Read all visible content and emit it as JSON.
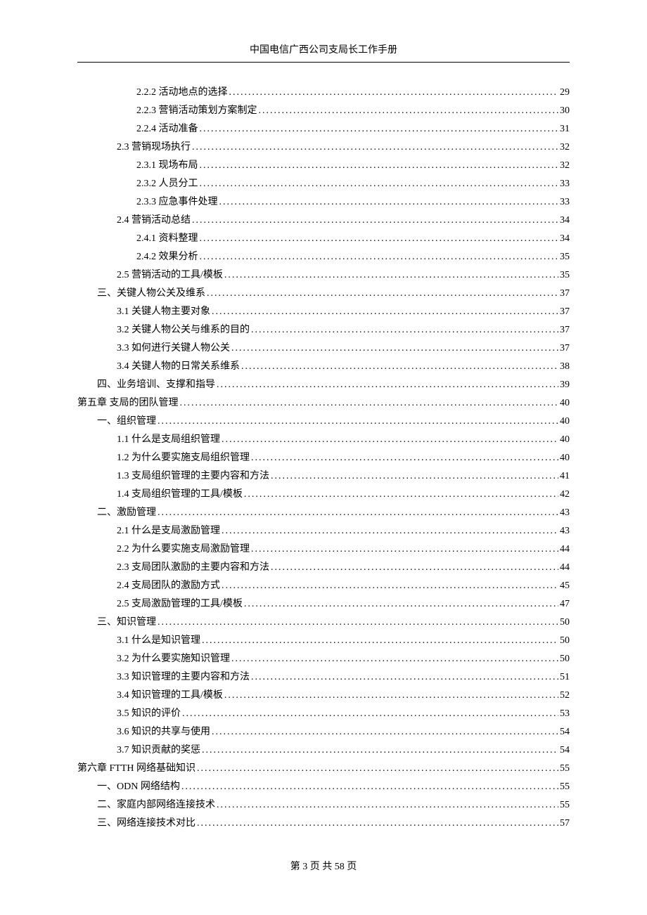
{
  "header": {
    "title": "中国电信广西公司支局长工作手册"
  },
  "toc": [
    {
      "indent": 3,
      "title": "2.2.2 活动地点的选择",
      "page": "29"
    },
    {
      "indent": 3,
      "title": "2.2.3 营销活动策划方案制定",
      "page": "30"
    },
    {
      "indent": 3,
      "title": "2.2.4 活动准备",
      "page": "31"
    },
    {
      "indent": 2,
      "title": "2.3 营销现场执行",
      "page": "32"
    },
    {
      "indent": 3,
      "title": "2.3.1 现场布局",
      "page": "32"
    },
    {
      "indent": 3,
      "title": "2.3.2 人员分工",
      "page": "33"
    },
    {
      "indent": 3,
      "title": "2.3.3 应急事件处理",
      "page": "33"
    },
    {
      "indent": 2,
      "title": "2.4 营销活动总结",
      "page": "34"
    },
    {
      "indent": 3,
      "title": "2.4.1 资料整理",
      "page": "34"
    },
    {
      "indent": 3,
      "title": "2.4.2 效果分析",
      "page": "35"
    },
    {
      "indent": 2,
      "title": "2.5 营销活动的工具/模板",
      "page": "35"
    },
    {
      "indent": 1,
      "title": "三、关键人物公关及维系",
      "page": "37"
    },
    {
      "indent": 2,
      "title": "3.1 关键人物主要对象",
      "page": "37"
    },
    {
      "indent": 2,
      "title": "3.2 关键人物公关与维系的目的",
      "page": "37"
    },
    {
      "indent": 2,
      "title": "3.3 如何进行关键人物公关",
      "page": "37"
    },
    {
      "indent": 2,
      "title": "3.4 关键人物的日常关系维系",
      "page": "38"
    },
    {
      "indent": 1,
      "title": "四、业务培训、支撑和指导",
      "page": "39"
    },
    {
      "indent": 0,
      "title": "第五章 支局的团队管理 ",
      "page": "40"
    },
    {
      "indent": 1,
      "title": "一、组织管理",
      "page": "40"
    },
    {
      "indent": 2,
      "title": "1.1 什么是支局组织管理",
      "page": "40"
    },
    {
      "indent": 2,
      "title": "1.2 为什么要实施支局组织管理",
      "page": "40"
    },
    {
      "indent": 2,
      "title": "1.3 支局组织管理的主要内容和方法",
      "page": "41"
    },
    {
      "indent": 2,
      "title": "1.4 支局组织管理的工具/模板",
      "page": "42"
    },
    {
      "indent": 1,
      "title": "二、激励管理",
      "page": "43"
    },
    {
      "indent": 2,
      "title": "2.1 什么是支局激励管理",
      "page": "43"
    },
    {
      "indent": 2,
      "title": "2.2 为什么要实施支局激励管理",
      "page": "44"
    },
    {
      "indent": 2,
      "title": "2.3 支局团队激励的主要内容和方法",
      "page": "44"
    },
    {
      "indent": 2,
      "title": "2.4 支局团队的激励方式",
      "page": "45"
    },
    {
      "indent": 2,
      "title": "2.5 支局激励管理的工具/模板",
      "page": "47"
    },
    {
      "indent": 1,
      "title": "三、知识管理",
      "page": "50"
    },
    {
      "indent": 2,
      "title": "3.1 什么是知识管理",
      "page": "50"
    },
    {
      "indent": 2,
      "title": "3.2 为什么要实施知识管理",
      "page": "50"
    },
    {
      "indent": 2,
      "title": "3.3 知识管理的主要内容和方法",
      "page": "51"
    },
    {
      "indent": 2,
      "title": "3.4 知识管理的工具/模板",
      "page": "52"
    },
    {
      "indent": 2,
      "title": "3.5 知识的评价",
      "page": "53"
    },
    {
      "indent": 2,
      "title": "3.6 知识的共享与使用",
      "page": "54"
    },
    {
      "indent": 2,
      "title": "3.7 知识贡献的奖惩",
      "page": "54"
    },
    {
      "indent": 0,
      "title": "第六章 FTTH 网络基础知识 ",
      "page": "55"
    },
    {
      "indent": 1,
      "title": "一、ODN 网络结构",
      "page": "55"
    },
    {
      "indent": 1,
      "title": "二、家庭内部网络连接技术",
      "page": "55"
    },
    {
      "indent": 1,
      "title": "三、网络连接技术对比",
      "page": "57"
    }
  ],
  "footer": {
    "text": "第 3 页 共 58 页"
  }
}
